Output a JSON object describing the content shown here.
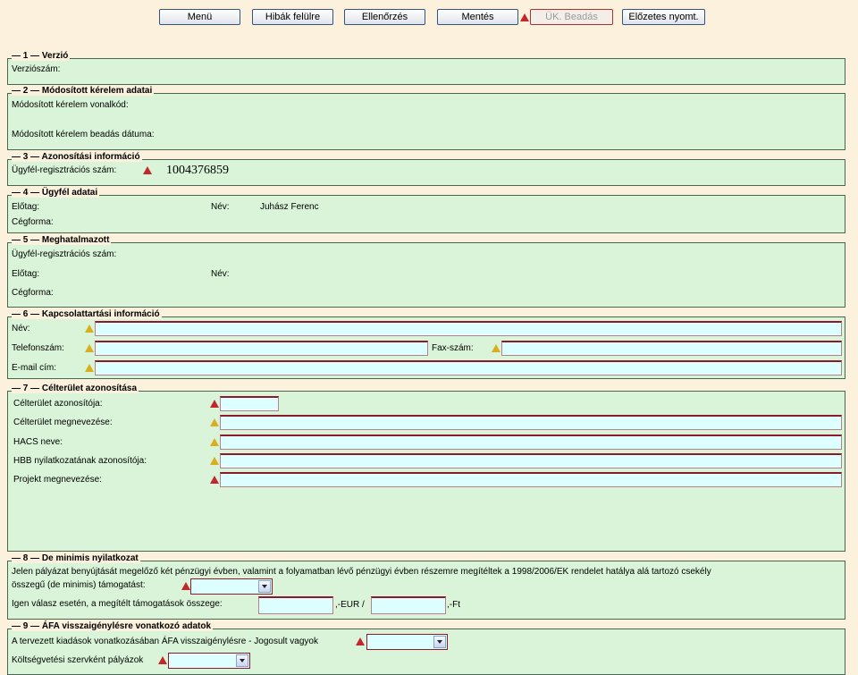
{
  "toolbar": {
    "menu": "Menü",
    "errors_top": "Hibák felülre",
    "check": "Ellenőrzés",
    "save": "Mentés",
    "submit": "ÜK. Beadás",
    "preprint": "Előzetes nyomt."
  },
  "s1": {
    "num": "1",
    "title": "Verzió",
    "version_label": "Verziószám:"
  },
  "s2": {
    "num": "2",
    "title": "Módosított kérelem adatai",
    "barcode_label": "Módosított kérelem vonalkód:",
    "date_label": "Módosított kérelem beadás dátuma:"
  },
  "s3": {
    "num": "3",
    "title": "Azonosítási információ",
    "reg_label": "Ügyfél-regisztrációs szám:",
    "reg_value": "1004376859"
  },
  "s4": {
    "num": "4",
    "title": "Ügyfél adatai",
    "prefix_label": "Előtag:",
    "name_label": "Név:",
    "name_value": "Juhász Ferenc",
    "company_label": "Cégforma:"
  },
  "s5": {
    "num": "5",
    "title": "Meghatalmazott",
    "reg_label": "Ügyfél-regisztrációs szám:",
    "prefix_label": "Előtag:",
    "name_label": "Név:",
    "company_label": "Cégforma:"
  },
  "s6": {
    "num": "6",
    "title": "Kapcsolattartási információ",
    "name_label": "Név:",
    "phone_label": "Telefonszám:",
    "fax_label": "Fax-szám:",
    "email_label": "E-mail cím:"
  },
  "s7": {
    "num": "7",
    "title": "Célterület azonosítása",
    "area_id_label": "Célterület azonosítója:",
    "area_name_label": "Célterület megnevezése:",
    "hacs_label": "HACS neve:",
    "hbb_label": "HBB nyilatkozatának azonosítója:",
    "project_label": "Projekt megnevezése:"
  },
  "s8": {
    "num": "8",
    "title": "De minimis nyilatkozat",
    "text_line1": "Jelen pályázat benyújtását megelőző két pénzügyi évben, valamint a folyamatban lévő pénzügyi évben részemre megítéltek a 1998/2006/EK rendelet hatálya alá tartozó csekély",
    "text_line2": "összegű (de minimis) támogatást:",
    "yes_label": "Igen válasz esetén, a megítélt támogatások összege:",
    "eur_suffix": ",-EUR /",
    "ft_suffix": ",-Ft"
  },
  "s9": {
    "num": "9",
    "title": "ÁFA visszaigénylésre vonatkozó adatok",
    "vat_label": "A tervezett kiadások vonatkozásában ÁFA visszaigénylésre - Jogosult vagyok",
    "budget_label": "Költségvetési szervként pályázok"
  }
}
